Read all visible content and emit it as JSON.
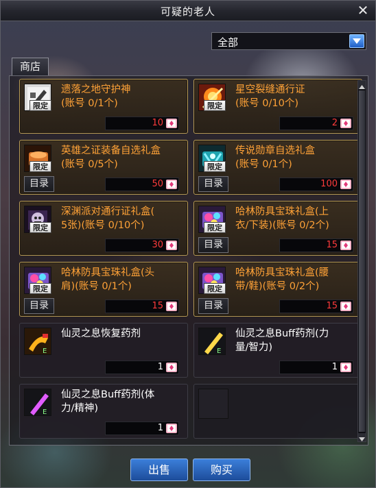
{
  "window": {
    "title": "可疑的老人"
  },
  "filter": {
    "selected": "全部"
  },
  "tabs": [
    {
      "label": "商店"
    }
  ],
  "items": [
    {
      "lines": [
        "遗落之地守护神",
        "(账号 0/1个)"
      ],
      "price": "10",
      "limited": true,
      "catalog": false,
      "style": "gold",
      "icon": "guardian-icon"
    },
    {
      "lines": [
        "星空裂缝通行证",
        "(账号 0/10个)"
      ],
      "price": "2",
      "limited": true,
      "catalog": false,
      "style": "gold",
      "icon": "ticket-icon"
    },
    {
      "lines": [
        "英雄之证装备自选礼盒",
        "(账号 0/5个)"
      ],
      "price": "50",
      "limited": true,
      "catalog": true,
      "style": "gold",
      "icon": "hero-box-icon"
    },
    {
      "lines": [
        "传说勋章自选礼盒",
        "(账号 0/1个)"
      ],
      "price": "100",
      "limited": true,
      "catalog": true,
      "style": "gold",
      "icon": "medal-box-icon"
    },
    {
      "lines": [
        "深渊派对通行证礼盒(",
        "5张)(账号 0/10个)"
      ],
      "price": "30",
      "limited": true,
      "catalog": false,
      "style": "gold",
      "icon": "abyss-pass-icon"
    },
    {
      "lines": [
        "哈林防具宝珠礼盒(上",
        "衣/下装)(账号 0/2个)"
      ],
      "price": "15",
      "limited": true,
      "catalog": true,
      "style": "gold",
      "icon": "orb-box-icon"
    },
    {
      "lines": [
        "哈林防具宝珠礼盒(头",
        "肩)(账号 0/1个)"
      ],
      "price": "15",
      "limited": true,
      "catalog": true,
      "style": "gold",
      "icon": "orb-box-icon"
    },
    {
      "lines": [
        "哈林防具宝珠礼盒(腰",
        "带/鞋)(账号 0/2个)"
      ],
      "price": "15",
      "limited": true,
      "catalog": true,
      "style": "gold",
      "icon": "orb-box-icon"
    },
    {
      "lines": [
        "仙灵之息恢复药剂"
      ],
      "price": "1",
      "limited": false,
      "catalog": false,
      "style": "dark",
      "icon": "recovery-potion-icon"
    },
    {
      "lines": [
        "仙灵之息Buff药剂(力",
        "量/智力)"
      ],
      "price": "1",
      "limited": false,
      "catalog": false,
      "style": "dark",
      "icon": "buff-potion-icon"
    },
    {
      "lines": [
        "仙灵之息Buff药剂(体",
        "力/精神)"
      ],
      "price": "1",
      "limited": false,
      "catalog": false,
      "style": "dark",
      "icon": "buff-potion-icon"
    }
  ],
  "badges": {
    "limited": "限定",
    "catalog": "目录"
  },
  "buttons": {
    "sell": "出售",
    "buy": "购买"
  },
  "colors": {
    "limited_name": "#ffa237",
    "normal_name": "#ffffff",
    "price_limited": "#ff3b3b",
    "button": "#2f6fcd"
  }
}
